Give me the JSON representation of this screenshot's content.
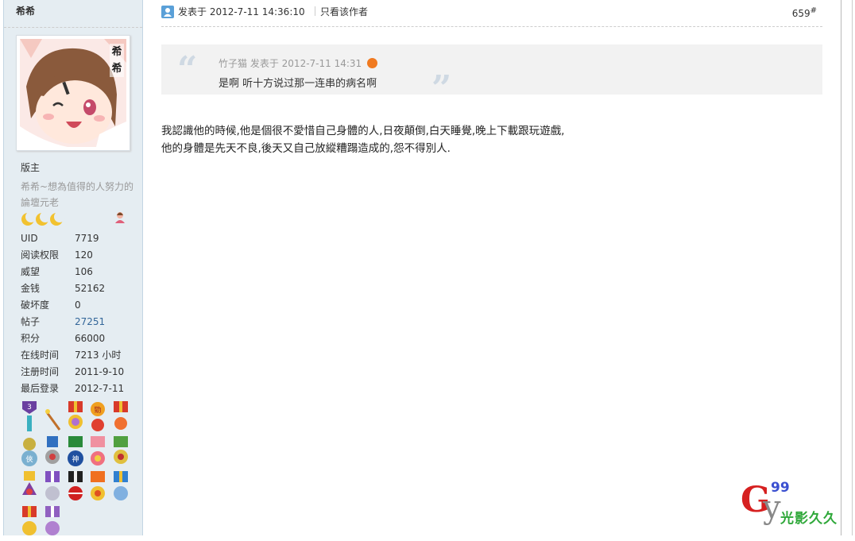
{
  "sidebar": {
    "username": "希希",
    "avatar_tag": "希希",
    "rank": "版主",
    "custom_title": "希希~想為值得的人努力的論壇元老",
    "stats": [
      {
        "label": "UID",
        "value": "7719"
      },
      {
        "label": "阅读权限",
        "value": "120"
      },
      {
        "label": "威望",
        "value": "106"
      },
      {
        "label": "金钱",
        "value": "52162"
      },
      {
        "label": "破坏度",
        "value": "0"
      },
      {
        "label": "帖子",
        "value": "27251"
      },
      {
        "label": "积分",
        "value": "66000"
      },
      {
        "label": "在线时间",
        "value": "7213 小时"
      },
      {
        "label": "注册时间",
        "value": "2011-9-10"
      },
      {
        "label": "最后登录",
        "value": "2012-7-11"
      }
    ],
    "medal_count": 17
  },
  "post": {
    "posted_at": "发表于 2012-7-11 14:36:10",
    "only_author": "只看该作者",
    "floor": "659",
    "floor_suffix": "#",
    "quote": {
      "author": "竹子猫",
      "posted_at": "发表于 2012-7-11 14:31",
      "text": "是啊 听十方说过那一连串的病名啊"
    },
    "body_lines": [
      "我認識他的時候,他是個很不愛惜自己身體的人,日夜顛倒,白天睡覺,晚上下載跟玩遊戲,",
      "他的身體是先天不良,後天又自己放縱糟蹋造成的,怨不得別人."
    ]
  },
  "watermark": {
    "letters": "G",
    "letter2": "y",
    "number": "99",
    "text": "光影久久"
  },
  "colors": {
    "sidebar_bg": "#e5edf2",
    "link": "#336699",
    "quote_bg": "#f2f2f2"
  }
}
